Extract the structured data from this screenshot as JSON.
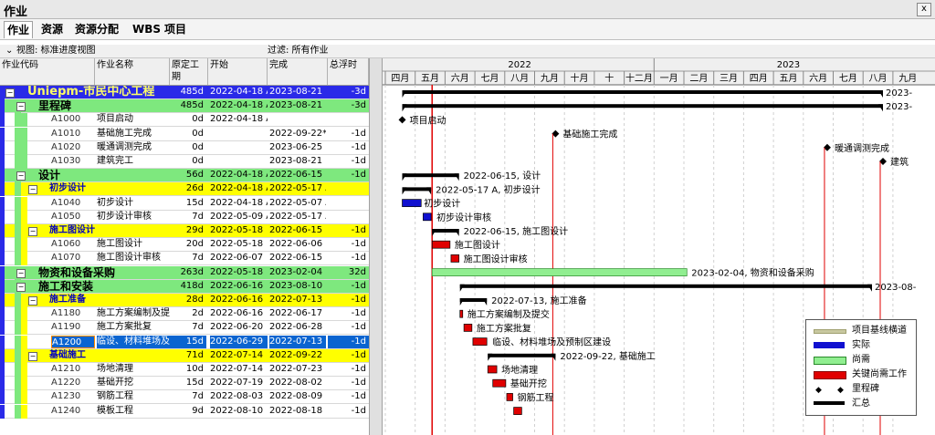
{
  "window": {
    "title": "作业",
    "close_glyph": "x"
  },
  "tabs": [
    "作业",
    "资源",
    "资源分配",
    "WBS",
    "项目"
  ],
  "view_bar": {
    "view_label": "视图: 标准进度视图",
    "filter_label": "过滤: 所有作业"
  },
  "columns": [
    "作业代码",
    "作业名称",
    "原定工期",
    "开始",
    "完成",
    "总浮时"
  ],
  "timeline": {
    "years": [
      "2022",
      "2023"
    ],
    "months": [
      "四月",
      "五月",
      "六月",
      "七月",
      "八月",
      "九月",
      "十月",
      "十",
      "十二月",
      "一月",
      "二月",
      "三月",
      "四月",
      "五月",
      "六月",
      "七月",
      "八月",
      "九月"
    ]
  },
  "colors": {
    "project": "#2a2ae8",
    "wbs1": "#7ee87e",
    "wbs2": "#ffff00",
    "selected": "#0a64d0",
    "actual_bar": "#1010d0",
    "remaining_bar": "#90ee90",
    "critical_bar": "#e00000"
  },
  "rows": [
    {
      "type": "project",
      "code": "Uniepm-市民中心工程",
      "dur": "485d",
      "start": "2022-04-18 A",
      "finish": "2023-08-21",
      "float": "-3d"
    },
    {
      "type": "wbs1",
      "code": "里程碑",
      "dur": "485d",
      "start": "2022-04-18 A",
      "finish": "2023-08-21",
      "float": "-3d"
    },
    {
      "type": "task",
      "code": "A1000",
      "name": "项目启动",
      "dur": "0d",
      "start": "2022-04-18 A",
      "finish": "",
      "float": ""
    },
    {
      "type": "task",
      "code": "A1010",
      "name": "基础施工完成",
      "dur": "0d",
      "start": "",
      "finish": "2022-09-22*",
      "float": "-1d"
    },
    {
      "type": "task",
      "code": "A1020",
      "name": "暖通调测完成",
      "dur": "0d",
      "start": "",
      "finish": "2023-06-25",
      "float": "-1d"
    },
    {
      "type": "task",
      "code": "A1030",
      "name": "建筑完工",
      "dur": "0d",
      "start": "",
      "finish": "2023-08-21",
      "float": "-1d"
    },
    {
      "type": "wbs1",
      "code": "设计",
      "dur": "56d",
      "start": "2022-04-18 A",
      "finish": "2022-06-15",
      "float": "-1d"
    },
    {
      "type": "wbs2",
      "code": "初步设计",
      "dur": "26d",
      "start": "2022-04-18 A",
      "finish": "2022-05-17 A",
      "float": ""
    },
    {
      "type": "task",
      "code": "A1040",
      "name": "初步设计",
      "dur": "15d",
      "start": "2022-04-18 A",
      "finish": "2022-05-07 A",
      "float": ""
    },
    {
      "type": "task",
      "code": "A1050",
      "name": "初步设计审核",
      "dur": "7d",
      "start": "2022-05-09 A",
      "finish": "2022-05-17 A",
      "float": ""
    },
    {
      "type": "wbs2",
      "code": "施工图设计",
      "dur": "29d",
      "start": "2022-05-18",
      "finish": "2022-06-15",
      "float": "-1d"
    },
    {
      "type": "task",
      "code": "A1060",
      "name": "施工图设计",
      "dur": "20d",
      "start": "2022-05-18",
      "finish": "2022-06-06",
      "float": "-1d"
    },
    {
      "type": "task",
      "code": "A1070",
      "name": "施工图设计审核",
      "dur": "7d",
      "start": "2022-06-07",
      "finish": "2022-06-15",
      "float": "-1d"
    },
    {
      "type": "wbs1",
      "code": "物资和设备采购",
      "dur": "263d",
      "start": "2022-05-18",
      "finish": "2023-02-04",
      "float": "32d"
    },
    {
      "type": "wbs1",
      "code": "施工和安装",
      "dur": "418d",
      "start": "2022-06-16",
      "finish": "2023-08-10",
      "float": "-1d"
    },
    {
      "type": "wbs2",
      "code": "施工准备",
      "dur": "28d",
      "start": "2022-06-16",
      "finish": "2022-07-13",
      "float": "-1d"
    },
    {
      "type": "task",
      "code": "A1180",
      "name": "施工方案编制及提",
      "dur": "2d",
      "start": "2022-06-16",
      "finish": "2022-06-17",
      "float": "-1d"
    },
    {
      "type": "task",
      "code": "A1190",
      "name": "施工方案批复",
      "dur": "7d",
      "start": "2022-06-20",
      "finish": "2022-06-28",
      "float": "-1d"
    },
    {
      "type": "task",
      "code": "A1200",
      "name": "临设、材料堆场及",
      "dur": "15d",
      "start": "2022-06-29",
      "finish": "2022-07-13",
      "float": "-1d",
      "selected": true
    },
    {
      "type": "wbs2",
      "code": "基础施工",
      "dur": "71d",
      "start": "2022-07-14",
      "finish": "2022-09-22",
      "float": "-1d"
    },
    {
      "type": "task",
      "code": "A1210",
      "name": "场地清理",
      "dur": "10d",
      "start": "2022-07-14",
      "finish": "2022-07-23",
      "float": "-1d"
    },
    {
      "type": "task",
      "code": "A1220",
      "name": "基础开挖",
      "dur": "15d",
      "start": "2022-07-19",
      "finish": "2022-08-02",
      "float": "-1d"
    },
    {
      "type": "task",
      "code": "A1230",
      "name": "钢筋工程",
      "dur": "7d",
      "start": "2022-08-03",
      "finish": "2022-08-09",
      "float": "-1d"
    },
    {
      "type": "task",
      "code": "A1240",
      "name": "模板工程",
      "dur": "9d",
      "start": "2022-08-10",
      "finish": "2022-08-18",
      "float": "-1d"
    }
  ],
  "gantt_labels": [
    "2023-",
    "2023-",
    "项目启动",
    "基础施工完成",
    "暖通调测完成",
    "建筑",
    "2022-06-15, 设计",
    "2022-05-17 A, 初步设计",
    "初步设计",
    "初步设计审核",
    "2022-06-15, 施工图设计",
    "施工图设计",
    "施工图设计审核",
    "2023-02-04, 物资和设备采购",
    "2023-08-",
    "2022-07-13, 施工准备",
    "施工方案编制及提交",
    "施工方案批复",
    "临设、材料堆场及预制区建设",
    "2022-09-22, 基础施工",
    "场地清理",
    "基础开挖",
    "钢筋工程",
    ""
  ],
  "legend": [
    "项目基线横道",
    "实际",
    "尚需",
    "关键尚需工作",
    "里程碑",
    "汇总"
  ]
}
